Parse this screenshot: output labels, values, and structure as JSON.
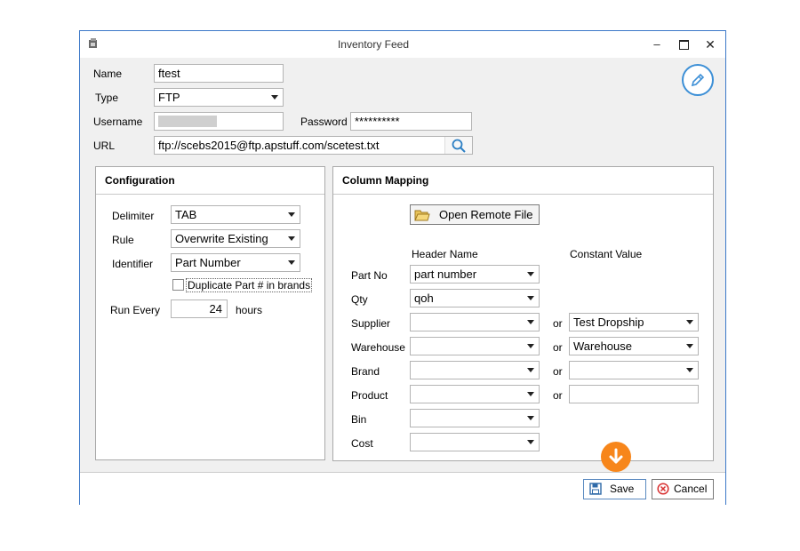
{
  "window": {
    "title": "Inventory Feed"
  },
  "form": {
    "name_label": "Name",
    "name_value": "ftest",
    "type_label": "Type",
    "type_value": "FTP",
    "username_label": "Username",
    "username_value": "",
    "password_label": "Password",
    "password_value": "**********",
    "url_label": "URL",
    "url_value": "ftp://scebs2015@ftp.apstuff.com/scetest.txt"
  },
  "configuration": {
    "title": "Configuration",
    "delimiter_label": "Delimiter",
    "delimiter_value": "TAB",
    "rule_label": "Rule",
    "rule_value": "Overwrite Existing",
    "identifier_label": "Identifier",
    "identifier_value": "Part Number",
    "duplicate_label": "Duplicate Part # in brands",
    "duplicate_checked": false,
    "run_every_label": "Run Every",
    "run_every_value": "24",
    "hours_label": "hours"
  },
  "mapping": {
    "title": "Column Mapping",
    "open_remote_label": "Open Remote File",
    "header_name_label": "Header Name",
    "constant_value_label": "Constant Value",
    "or_label": "or",
    "rows": [
      {
        "label": "Part No",
        "header": "part number"
      },
      {
        "label": "Qty",
        "header": "qoh"
      },
      {
        "label": "Supplier",
        "header": "",
        "constant": "Test Dropship"
      },
      {
        "label": "Warehouse",
        "header": "",
        "constant": "Warehouse"
      },
      {
        "label": "Brand",
        "header": "",
        "constant": ""
      },
      {
        "label": "Product",
        "header": "",
        "constant": ""
      },
      {
        "label": "Bin",
        "header": ""
      },
      {
        "label": "Cost",
        "header": ""
      }
    ]
  },
  "footer": {
    "save_label": "Save",
    "cancel_label": "Cancel"
  },
  "colors": {
    "accent": "#3c78c8",
    "orange": "#f7861b",
    "cancel_red": "#d83030"
  }
}
